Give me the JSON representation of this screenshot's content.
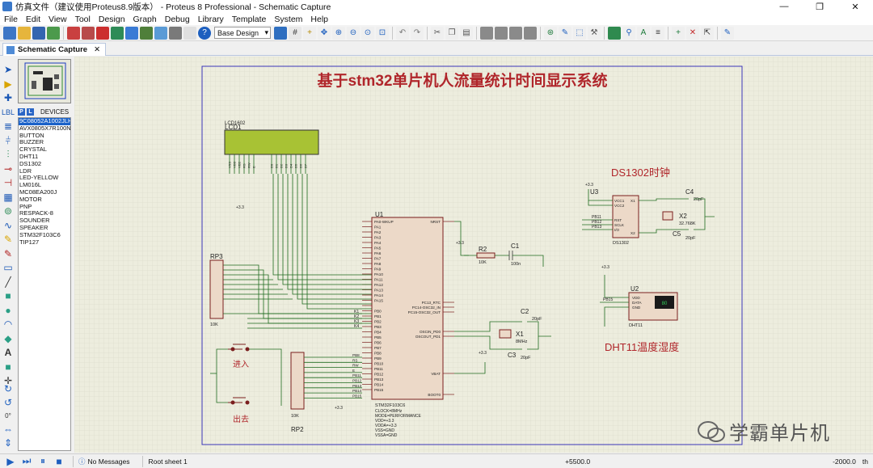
{
  "window": {
    "title": "仿真文件（建议使用Proteus8.9版本） - Proteus 8 Professional - Schematic Capture",
    "minimize": "—",
    "maximize": "❐",
    "close": "✕"
  },
  "menu": [
    "File",
    "Edit",
    "View",
    "Tool",
    "Design",
    "Graph",
    "Debug",
    "Library",
    "Template",
    "System",
    "Help"
  ],
  "toolbar": {
    "design_combo": "Base Design"
  },
  "tab": {
    "label": "Schematic Capture",
    "close": "✕"
  },
  "devices": {
    "header_p": "P",
    "header_l": "L",
    "header_label": "DEVICES",
    "items": [
      "9C08052A1002JLH",
      "AVX0805X7R100N",
      "BUTTON",
      "BUZZER",
      "CRYSTAL",
      "DHT11",
      "DS1302",
      "LDR",
      "LED-YELLOW",
      "LM016L",
      "MC08EA200J",
      "MOTOR",
      "PNP",
      "RESPACK-8",
      "SOUNDER",
      "SPEAKER",
      "STM32F103C6",
      "TIP127"
    ],
    "selected_index": 0
  },
  "schematic": {
    "title": "基于stm32单片机人流量统计时间显示系统",
    "ds1302_label": "DS1302时钟",
    "dht11_label": "DHT11温度湿度",
    "enter_label": "进入",
    "exit_label": "出去",
    "lcd_ref": "LCD1",
    "lcd_part": "LCD1602",
    "u1_ref": "U1",
    "u1_part": "STM32F103C6",
    "u1_props": [
      "CLOCK=8MHz",
      "MODE=PERFORMANCE",
      "VDD=+3.3",
      "VDDA=+3.3",
      "VSS=GND",
      "VSSA=GND"
    ],
    "u3_ref": "U3",
    "u3_part": "DS1302",
    "u2_ref": "U2",
    "u2_part": "DHT11",
    "rp3_ref": "RP3",
    "rp3_val": "10K",
    "rp2_ref": "RP2",
    "rp2_val": "10K",
    "r2_ref": "R2",
    "r2_val": "10K",
    "c1_ref": "C1",
    "c1_val": "100n",
    "c2_ref": "C2",
    "c2_val": "20pF",
    "c3_ref": "C3",
    "c3_val": "20pF",
    "c4_ref": "C4",
    "c4_val": "20pF",
    "c5_ref": "C5",
    "c5_val": "20pF",
    "x1_ref": "X1",
    "x1_val": "8MHz",
    "x2_ref": "X2",
    "x2_val": "32.768K",
    "vcc_label": "+3.3",
    "u1_left_pins": [
      "PA0-WKUP",
      "PA1",
      "PA2",
      "PA3",
      "PA4",
      "PA5",
      "PA6",
      "PA7",
      "PA8",
      "PA9",
      "PA10",
      "PA11",
      "PA12",
      "PA13",
      "PA14",
      "PA15",
      "",
      "PB0",
      "PB1",
      "PB2",
      "PB3",
      "PB4",
      "PB5",
      "PB6",
      "PB7",
      "PB8",
      "PB9",
      "PB10",
      "PB11",
      "PB12",
      "PB13",
      "PB14",
      "PB15"
    ],
    "u1_right_pins": [
      "NRST",
      "PC13_RTC",
      "PC14-OSC32_IN",
      "PC15-OSC32_OUT",
      "OSCIN_PD0",
      "OSCOUT_PD1",
      "VBAT",
      "BOOT0"
    ],
    "lcd_pins": [
      "VSS",
      "VDD",
      "VEE",
      "RS",
      "RW",
      "E",
      "D0",
      "D1",
      "D2",
      "D3",
      "D4",
      "D5",
      "D6",
      "D7"
    ],
    "u3_pins": [
      "VCC1",
      "VCC2",
      "RST",
      "SCLK",
      "I/O",
      "X1",
      "X2"
    ],
    "u2_pins": [
      "VDD",
      "DATA",
      "GND"
    ],
    "net_k": [
      "K1",
      "K2",
      "K3",
      "K4"
    ],
    "net_pb": [
      "PB8",
      "RS",
      "RW",
      "E",
      "PB11",
      "PB12",
      "PB13",
      "PB14",
      "PB15"
    ],
    "pb_left": [
      "PB11",
      "PB12",
      "PB13"
    ],
    "dht_net": "PB15",
    "dht_display": "80"
  },
  "status": {
    "messages": "No Messages",
    "sheet": "Root sheet 1",
    "x_coord": "+5500.0",
    "y_coord": "-2000.0",
    "unit": "th"
  },
  "watermark": "学霸单片机"
}
